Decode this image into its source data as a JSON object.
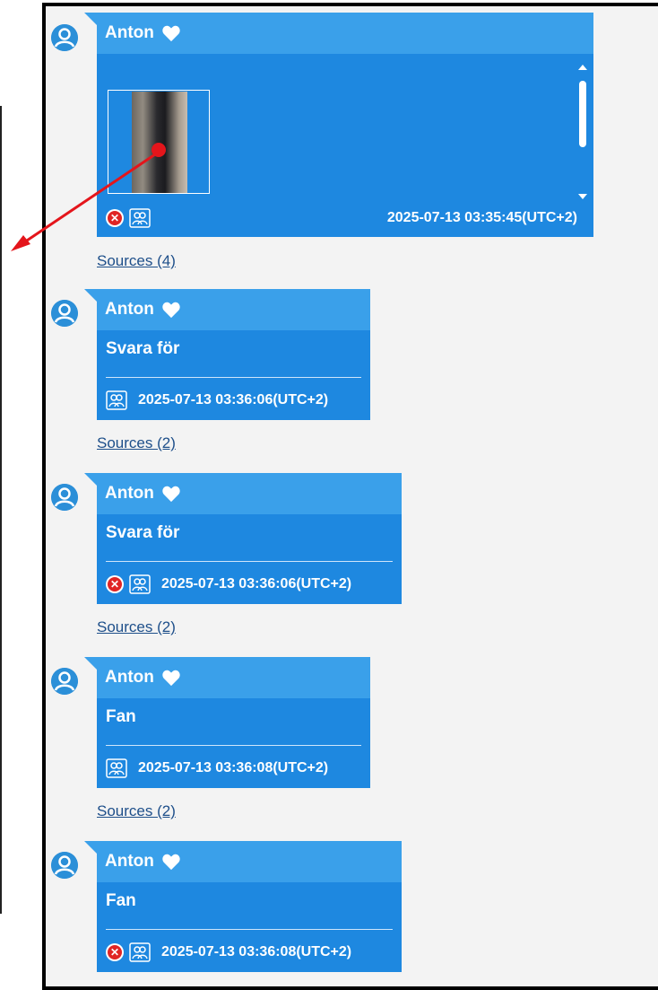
{
  "colors": {
    "bubble": "#1e88e0",
    "bubble_header": "#3aa0ea",
    "link": "#1e4f8a",
    "delete": "#e02424",
    "annotation_arrow": "#e4151b"
  },
  "messages": [
    {
      "sender": "Anton",
      "type": "image",
      "has_delete": true,
      "timestamp": "2025-07-13 03:35:45(UTC+2)",
      "sources": "Sources (4)"
    },
    {
      "sender": "Anton",
      "text": "Svara för",
      "has_delete": false,
      "timestamp": "2025-07-13 03:36:06(UTC+2)",
      "sources": "Sources (2)"
    },
    {
      "sender": "Anton",
      "text": "Svara för",
      "has_delete": true,
      "timestamp": "2025-07-13 03:36:06(UTC+2)",
      "sources": "Sources (2)"
    },
    {
      "sender": "Anton",
      "text": "Fan",
      "has_delete": false,
      "timestamp": "2025-07-13 03:36:08(UTC+2)",
      "sources": "Sources (2)"
    },
    {
      "sender": "Anton",
      "text": "Fan",
      "has_delete": true,
      "timestamp": "2025-07-13 03:36:08(UTC+2)"
    }
  ],
  "icons": {
    "avatar": "user-avatar-icon",
    "heart": "heart-icon",
    "delete": "delete-x-icon",
    "participants": "participants-icon"
  }
}
